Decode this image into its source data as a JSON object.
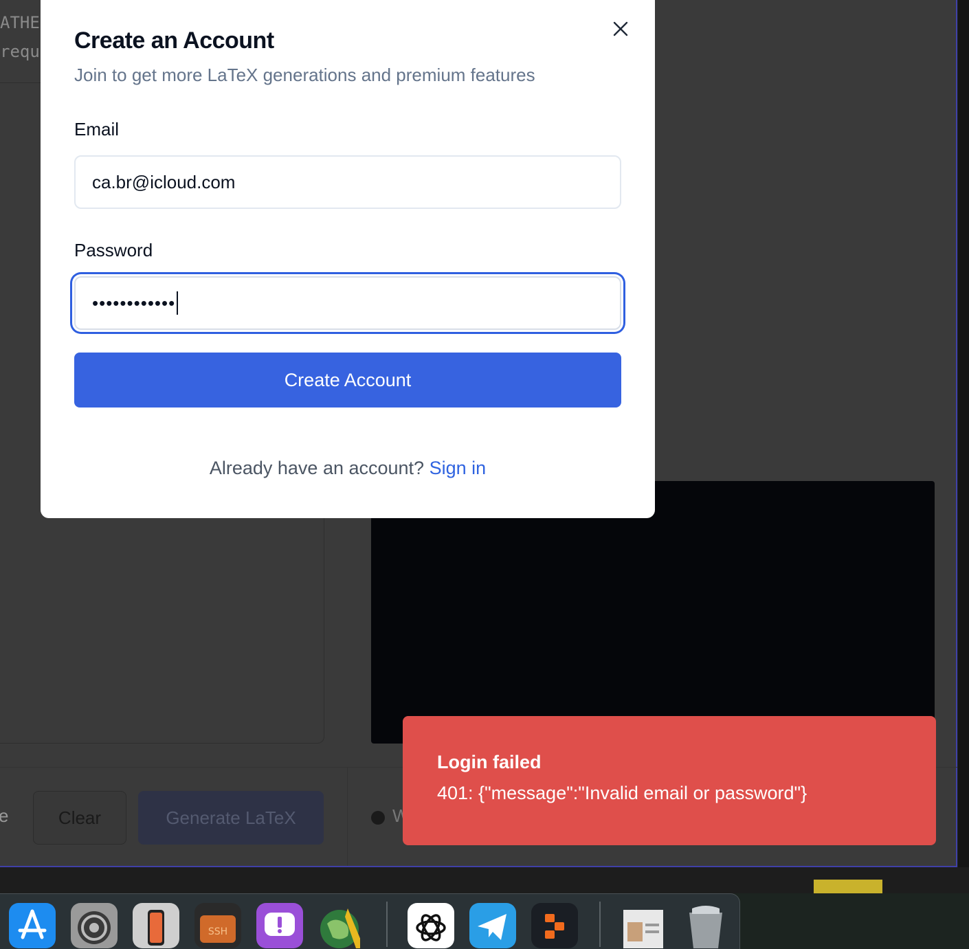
{
  "background": {
    "code_lines": [
      "ATHE",
      "requ"
    ],
    "partial_label_left": "e",
    "clear_button": "Clear",
    "generate_button": "Generate LaTeX",
    "partial_label_right": "W"
  },
  "modal": {
    "title": "Create an Account",
    "subtitle": "Join to get more LaTeX generations and premium features",
    "email_label": "Email",
    "email_value": "ca.br@icloud.com",
    "password_label": "Password",
    "password_value": "••••••••••••",
    "submit_label": "Create Account",
    "signin_prompt": "Already have an account?",
    "signin_link": "Sign in",
    "close_icon": "close-icon"
  },
  "toast": {
    "title": "Login failed",
    "message": "401: {\"message\":\"Invalid email or password\"}"
  },
  "dock": {
    "items": [
      "app-store-icon",
      "system-settings-icon",
      "iphone-mirroring-icon",
      "ssh-app-icon",
      "feedback-icon",
      "globe-app-icon",
      "chatgpt-icon",
      "telegram-icon",
      "replit-icon",
      "document-icon",
      "trash-icon"
    ]
  },
  "colors": {
    "accent": "#3763e0",
    "toast_bg": "#df4f4b",
    "focus_ring": "#2f5fe0"
  }
}
